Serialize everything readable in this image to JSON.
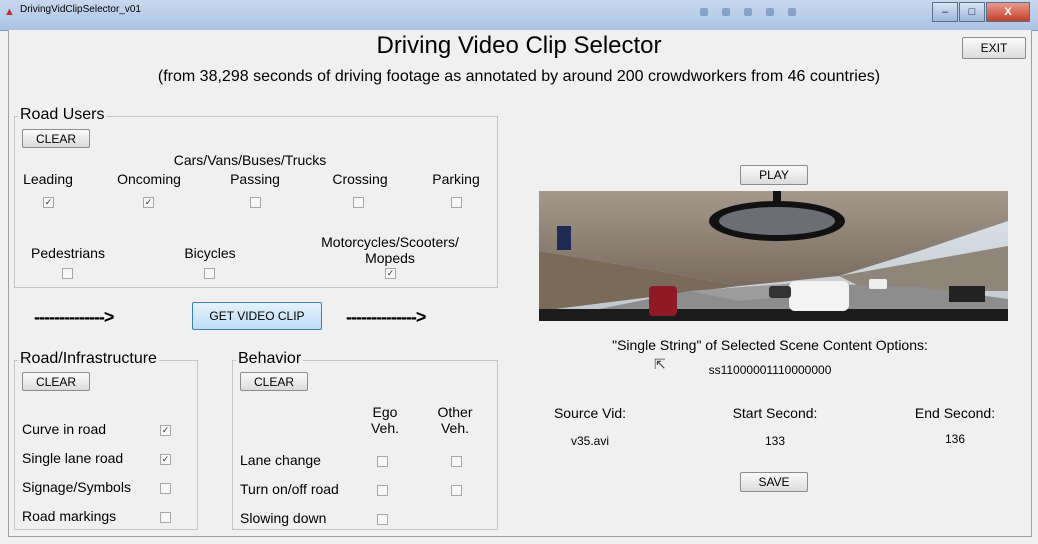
{
  "window": {
    "title": "DrivingVidClipSelector_v01",
    "minimize": "–",
    "maximize": "□",
    "close": "X"
  },
  "header": {
    "title": "Driving Video Clip Selector",
    "subtitle": "(from 38,298 seconds of driving footage as annotated by around 200 crowdworkers from 46 countries)",
    "exit_label": "EXIT"
  },
  "road_users": {
    "title": "Road Users",
    "clear_label": "CLEAR",
    "group_label": "Cars/Vans/Buses/Trucks",
    "items": [
      {
        "label": "Leading",
        "checked": true
      },
      {
        "label": "Oncoming",
        "checked": true
      },
      {
        "label": "Passing",
        "checked": false
      },
      {
        "label": "Crossing",
        "checked": false
      },
      {
        "label": "Parking",
        "checked": false
      }
    ],
    "others": [
      {
        "label": "Pedestrians",
        "checked": false
      },
      {
        "label": "Bicycles",
        "checked": false
      },
      {
        "label": "Motorcycles/Scooters/\nMopeds",
        "checked": true
      }
    ]
  },
  "middle": {
    "arrow_left": "-------------->",
    "get_clip_label": "GET VIDEO CLIP",
    "arrow_right": "-------------->"
  },
  "road_infra": {
    "title": "Road/Infrastructure",
    "clear_label": "CLEAR",
    "items": [
      {
        "label": "Curve in road",
        "checked": true
      },
      {
        "label": "Single lane road",
        "checked": true
      },
      {
        "label": "Signage/Symbols",
        "checked": false
      },
      {
        "label": "Road markings",
        "checked": false
      }
    ]
  },
  "behavior": {
    "title": "Behavior",
    "clear_label": "CLEAR",
    "col_ego": "Ego\nVeh.",
    "col_other": "Other\nVeh.",
    "rows": [
      {
        "label": "Lane change",
        "ego": false,
        "other": false
      },
      {
        "label": "Turn on/off road",
        "ego": false,
        "other": false
      },
      {
        "label": "Slowing down",
        "ego": false,
        "other": null
      }
    ]
  },
  "video": {
    "play_label": "PLAY",
    "single_string_label": "\"Single String\" of Selected Scene Content Options:",
    "single_string_value": "ss11000001110000000",
    "source_label": "Source Vid:",
    "source_value": "v35.avi",
    "start_label": "Start Second:",
    "start_value": "133",
    "end_label": "End Second:",
    "end_value": "136",
    "save_label": "SAVE"
  },
  "colors": {
    "accent_button": "#c7e3f7",
    "check": "#333333"
  }
}
